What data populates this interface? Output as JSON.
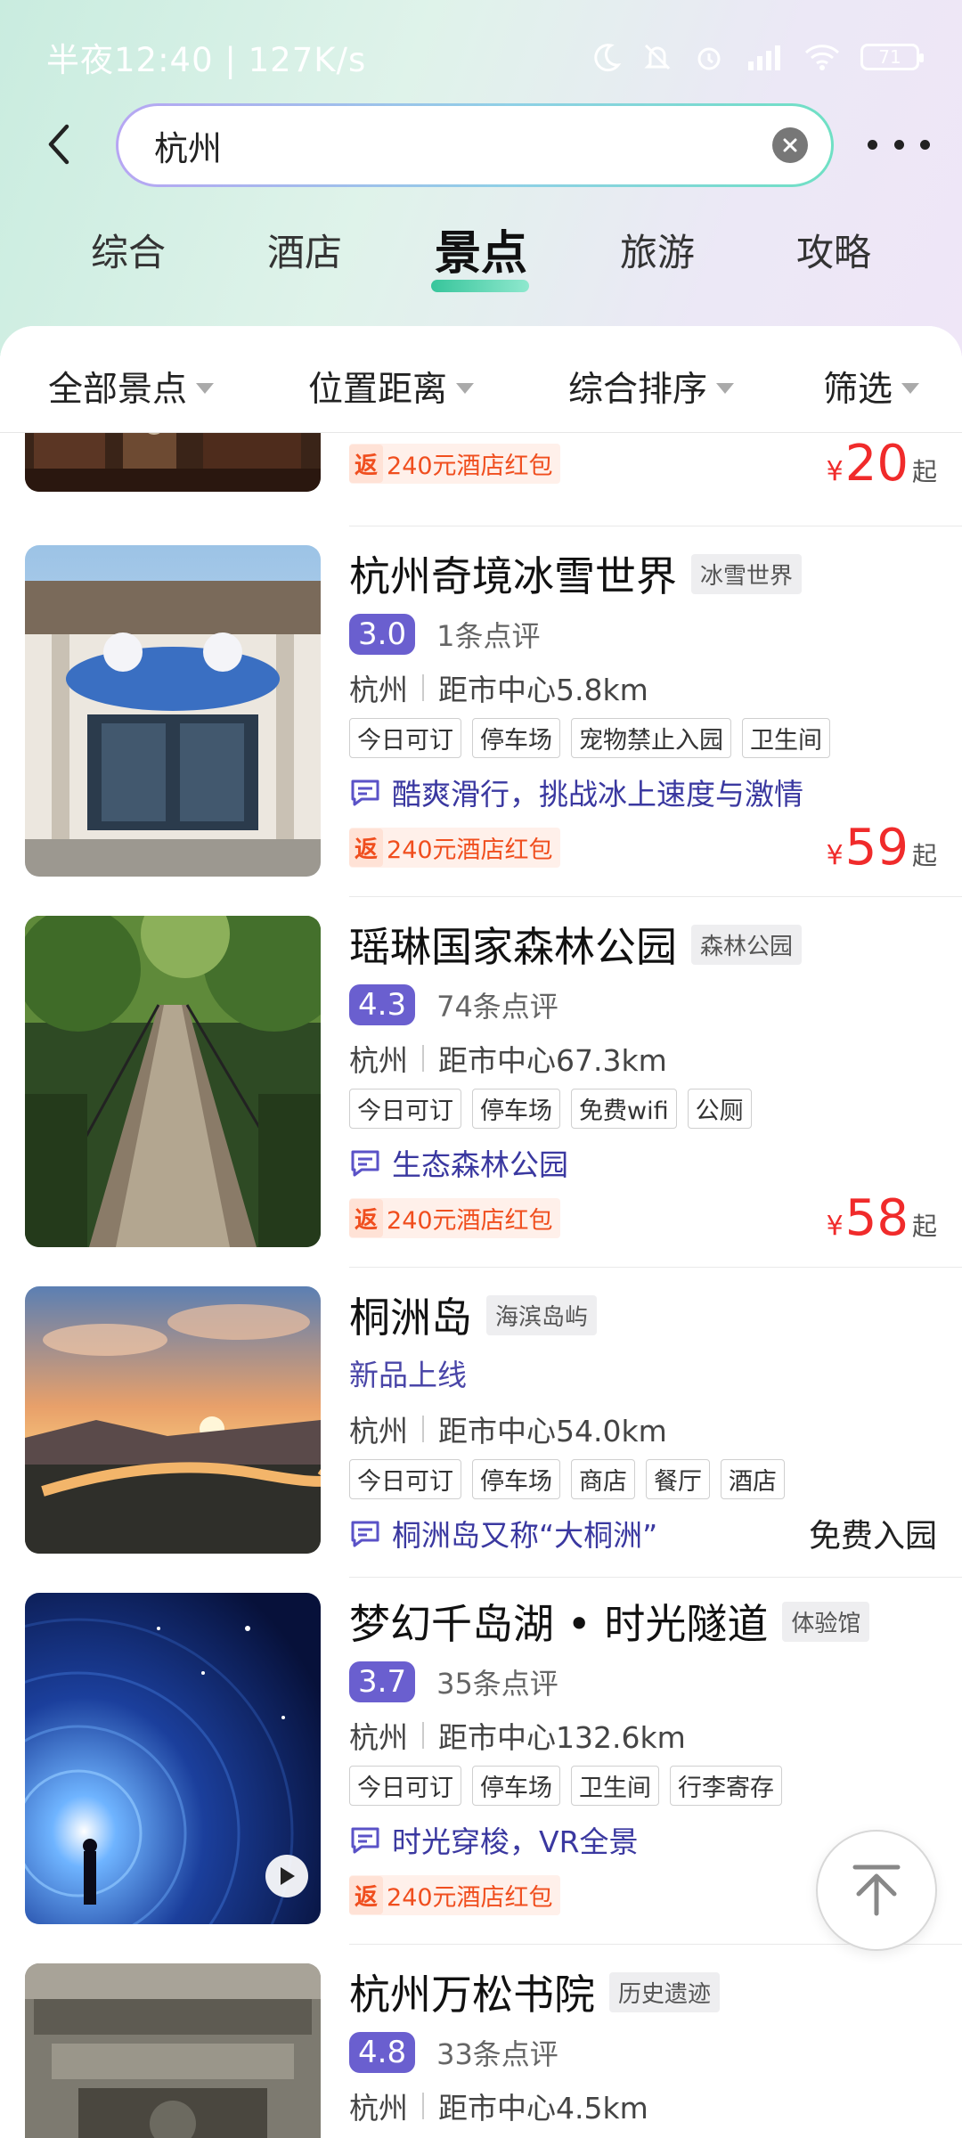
{
  "status_bar": {
    "time_text": "半夜12:40 | 127K/s",
    "battery": "71"
  },
  "search": {
    "query": "杭州"
  },
  "tabs": [
    {
      "label": "综合"
    },
    {
      "label": "酒店"
    },
    {
      "label": "景点"
    },
    {
      "label": "旅游"
    },
    {
      "label": "攻略"
    }
  ],
  "active_tab": "景点",
  "filters": [
    {
      "label": "全部景点"
    },
    {
      "label": "位置距离"
    },
    {
      "label": "综合排序"
    },
    {
      "label": "筛选"
    }
  ],
  "partial_item": {
    "promo_badge": "返",
    "promo_text": "240元酒店红包",
    "price_symbol": "¥",
    "price": "20",
    "price_suffix": "起"
  },
  "items": [
    {
      "name": "杭州奇境冰雪世界",
      "category": "冰雪世界",
      "score": "3.0",
      "reviews": "1条点评",
      "city": "杭州",
      "distance": "距市中心5.8km",
      "tags": [
        "今日可订",
        "停车场",
        "宠物禁止入园",
        "卫生间"
      ],
      "description": "酷爽滑行，挑战冰上速度与激情",
      "promo_badge": "返",
      "promo_text": "240元酒店红包",
      "price_symbol": "¥",
      "price": "59",
      "price_suffix": "起"
    },
    {
      "name": "瑶琳国家森林公园",
      "category": "森林公园",
      "score": "4.3",
      "reviews": "74条点评",
      "city": "杭州",
      "distance": "距市中心67.3km",
      "tags": [
        "今日可订",
        "停车场",
        "免费wifi",
        "公厕"
      ],
      "description": "生态森林公园",
      "promo_badge": "返",
      "promo_text": "240元酒店红包",
      "price_symbol": "¥",
      "price": "58",
      "price_suffix": "起"
    },
    {
      "name": "桐洲岛",
      "category": "海滨岛屿",
      "new_label": "新品上线",
      "city": "杭州",
      "distance": "距市中心54.0km",
      "tags": [
        "今日可订",
        "停车场",
        "商店",
        "餐厅",
        "酒店"
      ],
      "description": "桐洲岛又称“大桐洲”",
      "free_entry": "免费入园"
    },
    {
      "name": "梦幻千岛湖 • 时光隧道",
      "category": "体验馆",
      "score": "3.7",
      "reviews": "35条点评",
      "city": "杭州",
      "distance": "距市中心132.6km",
      "tags": [
        "今日可订",
        "停车场",
        "卫生间",
        "行李寄存"
      ],
      "description": "时光穿梭，VR全景",
      "promo_badge": "返",
      "promo_text": "240元酒店红包"
    },
    {
      "name": "杭州万松书院",
      "category": "历史遗迹",
      "score": "4.8",
      "reviews": "33条点评",
      "city": "杭州",
      "distance": "距市中心4.5km"
    }
  ],
  "icons": {
    "back": "back-arrow-icon",
    "clear": "clear-icon",
    "more": "more-icon",
    "desc": "chat-bubble-icon",
    "play": "play-icon",
    "top": "back-to-top-icon"
  },
  "colors": {
    "accent_purple": "#6a5fcf",
    "price_red": "#f02b2b",
    "promo_orange": "#f04e1e",
    "tab_underline_green": "#37c59b"
  }
}
